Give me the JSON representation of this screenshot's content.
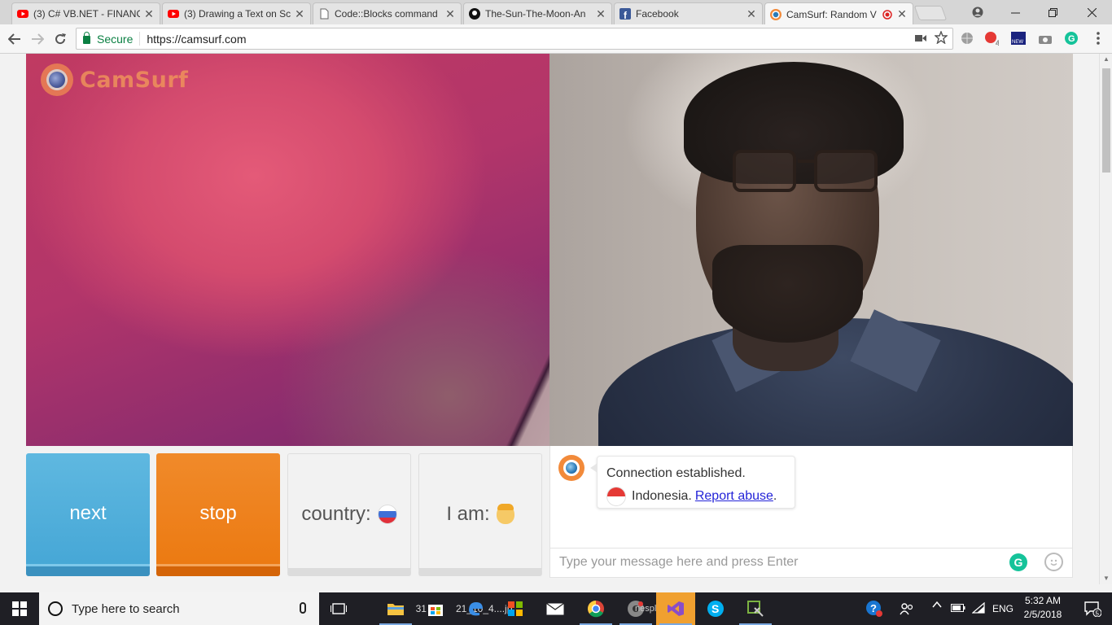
{
  "browser": {
    "tabs": [
      {
        "title": "(3) C# VB.NET - FINANC",
        "icon": "youtube-icon",
        "color": "#ff0000"
      },
      {
        "title": "(3) Drawing a Text on Sc",
        "icon": "youtube-icon",
        "color": "#ff0000"
      },
      {
        "title": "Code::Blocks command",
        "icon": "page-icon",
        "color": "#666666"
      },
      {
        "title": "The-Sun-The-Moon-An",
        "icon": "github-icon",
        "color": "#111111"
      },
      {
        "title": "Facebook",
        "icon": "facebook-icon",
        "color": "#3b5998"
      },
      {
        "title": "CamSurf: Random V",
        "icon": "camsurf-icon",
        "color": "#f28a3a",
        "active": true
      }
    ],
    "close_glyph": "✕",
    "secure_label": "Secure",
    "url": "https://camsurf.com",
    "extension_badge": "4"
  },
  "site": {
    "logo_text": "CamSurf",
    "buttons": {
      "next_label": "next",
      "stop_label": "stop",
      "country_label": "country:",
      "i_am_label": "I am:"
    },
    "chat": {
      "status_text": "Connection established.",
      "country_name": "Indonesia.",
      "report_link": "Report abuse",
      "report_suffix": ".",
      "input_placeholder": "Type your message here and press Enter",
      "grammarly_glyph": "G"
    },
    "colors": {
      "next": "#4aa9d8",
      "stop": "#ec7a12",
      "report_link": "#2323d8"
    }
  },
  "taskbar": {
    "search_placeholder": "Type here to search",
    "language": "ENG",
    "time": "5:32 AM",
    "date": "2/5/2018",
    "notification_count": "5",
    "hidden_window_text_1": "31",
    "hidden_window_text_2": "21_10_4....jp",
    "hidden_window_text_3": "nespla ba..."
  }
}
